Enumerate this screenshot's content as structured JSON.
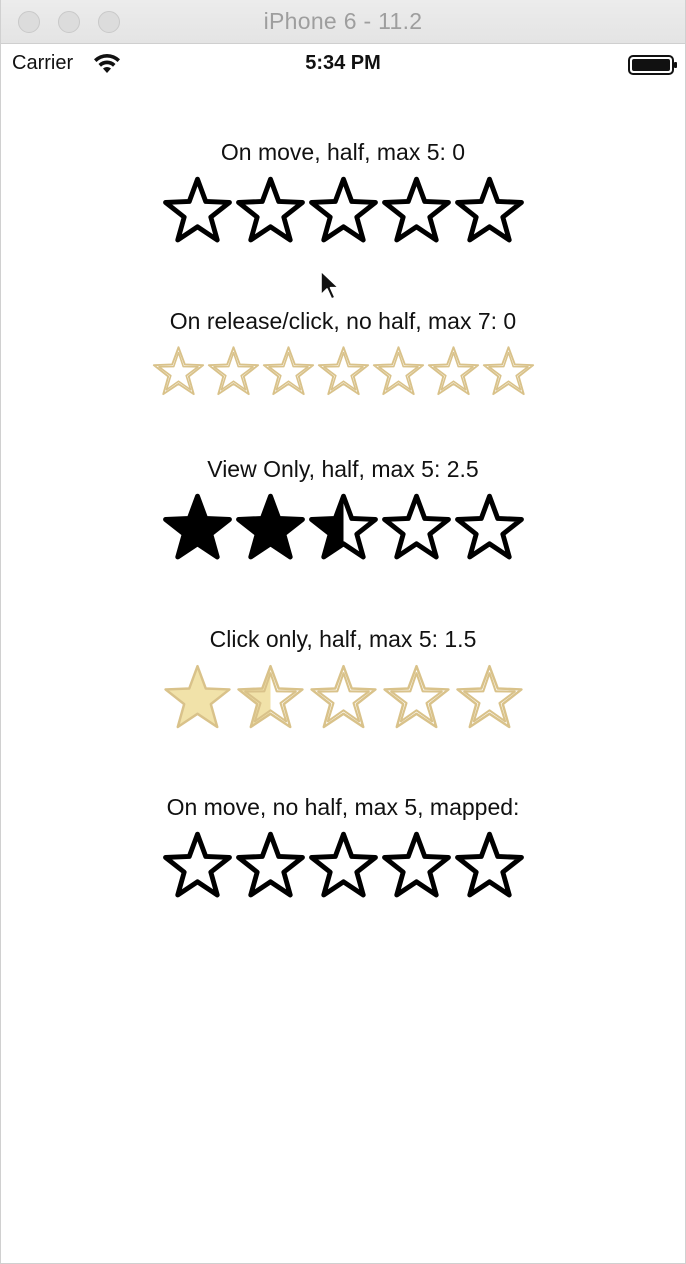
{
  "window": {
    "title": "iPhone 6 - 11.2"
  },
  "statusbar": {
    "carrier": "Carrier",
    "time": "5:34 PM",
    "wifi_icon": "wifi-icon",
    "battery_icon": "battery-icon"
  },
  "colors": {
    "black": "#000000",
    "gold_fill": "#f1e2a9",
    "gold_stroke": "#d9c28a"
  },
  "ratings": [
    {
      "label": "On move, half, max 5: 0",
      "max": 5,
      "value": 0,
      "style": "black",
      "size": "large"
    },
    {
      "label": "On release/click, no half, max 7: 0",
      "max": 7,
      "value": 0,
      "style": "gold",
      "size": "small"
    },
    {
      "label": "View Only, half, max 5: 2.5",
      "max": 5,
      "value": 2.5,
      "style": "black",
      "size": "large"
    },
    {
      "label": "Click only, half, max 5: 1.5",
      "max": 5,
      "value": 1.5,
      "style": "gold",
      "size": "large"
    },
    {
      "label": "On move, no half, max 5, mapped:",
      "max": 5,
      "value": 0,
      "style": "black",
      "size": "large"
    }
  ]
}
